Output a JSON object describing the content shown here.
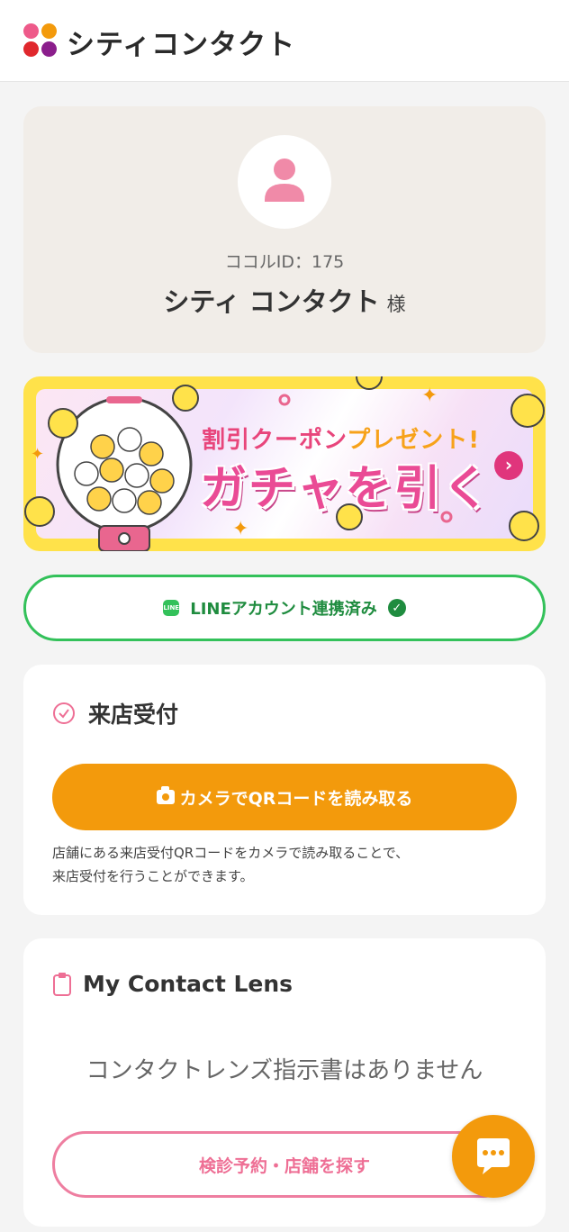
{
  "brand": {
    "name": "シティコンタクト",
    "logo_dot_colors": [
      "#ee5a8a",
      "#f39a0c",
      "#e0282d",
      "#8b1e8c"
    ]
  },
  "profile": {
    "member_id": "ココルID：175",
    "name": "シティ コンタクト",
    "honorific": "様",
    "avatar_icon": "user-icon",
    "avatar_color": "#f08aa8"
  },
  "banner": {
    "subtitle_pink": "割引クーポン",
    "subtitle_yellow": "プレゼント!",
    "title": "ガチャを引く",
    "arrow_icon": "chevron-right-icon"
  },
  "line": {
    "label": "LINEアカウント連携済み",
    "line_icon_text": "LINE",
    "status_icon": "check-circle-icon"
  },
  "visit": {
    "title": "来店受付",
    "icon": "check-circle-outline-icon",
    "button_label": "カメラでQRコードを読み取る",
    "button_icon": "camera-icon",
    "description_line1": "店舗にある来店受付QRコードをカメラで読み取ることで、",
    "description_line2": "来店受付を行うことができます。"
  },
  "lens": {
    "title": "My Contact Lens",
    "icon": "clipboard-icon",
    "empty_message": "コンタクトレンズ指示書はありません",
    "button_label": "検診予約・店舗を探す"
  },
  "chat": {
    "icon": "chat-bubble-icon"
  },
  "colors": {
    "accent_orange": "#f39a0c",
    "accent_pink": "#ee6f95",
    "line_green": "#33c15a",
    "profile_bg": "#f1ede8",
    "page_bg": "#f4f4f4"
  }
}
